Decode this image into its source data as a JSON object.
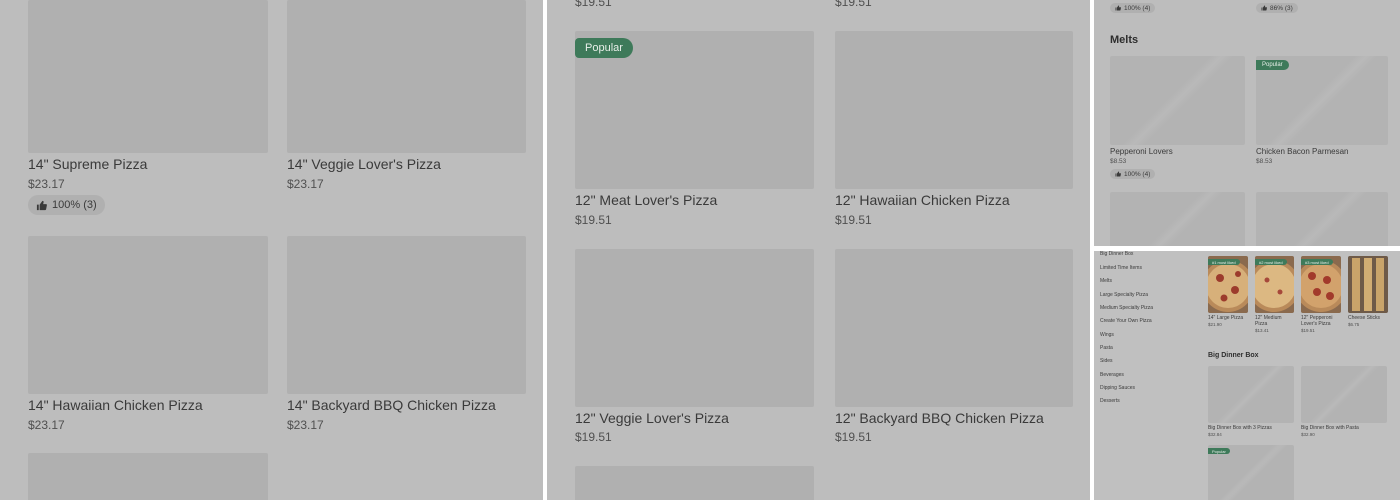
{
  "panel_a": {
    "items": [
      {
        "name": "14\" Supreme Pizza",
        "price": "$23.17"
      },
      {
        "name": "14\" Veggie Lover's Pizza",
        "price": "$23.17"
      },
      {
        "name": "14\" Hawaiian Chicken Pizza",
        "price": "$23.17"
      },
      {
        "name": "14\" Backyard BBQ Chicken Pizza",
        "price": "$23.17"
      }
    ],
    "rating": "100% (3)"
  },
  "panel_b": {
    "top_prices": [
      "$19.51",
      "$19.51"
    ],
    "badge": "Popular",
    "items": [
      {
        "name": "12\" Meat Lover's Pizza",
        "price": "$19.51"
      },
      {
        "name": "12\" Hawaiian Chicken Pizza",
        "price": "$19.51"
      },
      {
        "name": "12\" Veggie Lover's Pizza",
        "price": "$19.51"
      },
      {
        "name": "12\" Backyard BBQ Chicken Pizza",
        "price": "$19.51"
      }
    ]
  },
  "panel_c": {
    "top_ratings": [
      "100% (4)",
      "86% (3)"
    ],
    "section_title": "Melts",
    "badge": "Popular",
    "items": [
      {
        "name": "Pepperoni Lovers",
        "price": "$8.53",
        "rating": "100% (4)"
      },
      {
        "name": "Chicken Bacon Parmesan",
        "price": "$8.53"
      }
    ]
  },
  "panel_d": {
    "nav": [
      "Big Dinner Box",
      "Limited Time Items",
      "Melts",
      "Large Specialty Pizza",
      "Medium Specialty Pizza",
      "Create Your Own Pizza",
      "Wings",
      "Pasta",
      "Sides",
      "Beverages",
      "Dipping Sauces",
      "Desserts"
    ],
    "featured": [
      {
        "badge": "#1 most liked",
        "name": "14\" Large Pizza",
        "price": "$21.90"
      },
      {
        "badge": "#2 most liked",
        "name": "12\" Medium Pizza",
        "price": "$13.41"
      },
      {
        "badge": "#3 most liked",
        "name": "12\" Pepperoni Lover's Pizza",
        "price": "$19.51"
      },
      {
        "badge": "",
        "name": "Cheese Sticks",
        "price": "$6.75"
      }
    ],
    "section_title": "Big Dinner Box",
    "items": [
      {
        "name": "Big Dinner Box with 3 Pizzas",
        "price": "$32.84"
      },
      {
        "name": "Big Dinner Box with Pasta",
        "price": "$32.90"
      }
    ],
    "badge": "Popular"
  },
  "colors": {
    "overlay": "#bdbdbd",
    "placeholder": "#b0b0b0",
    "badge_green": "#3e7a5a"
  }
}
